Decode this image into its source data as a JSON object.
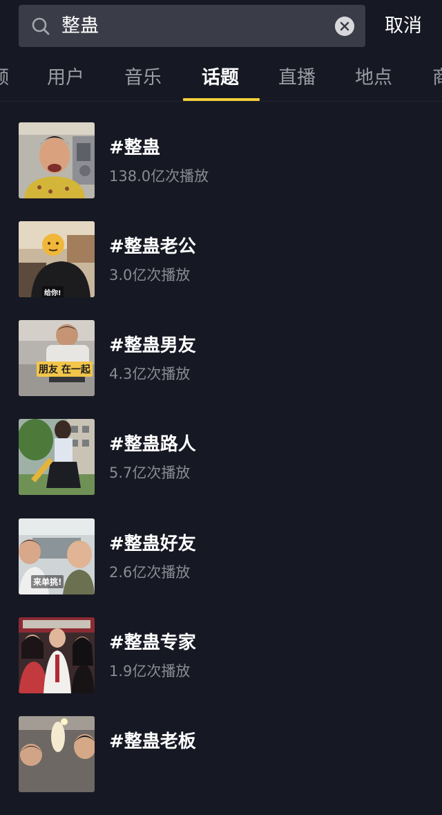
{
  "search": {
    "query": "整蛊",
    "cancel_label": "取消"
  },
  "tabs": [
    {
      "label": "频",
      "active": false
    },
    {
      "label": "用户",
      "active": false
    },
    {
      "label": "音乐",
      "active": false
    },
    {
      "label": "话题",
      "active": true
    },
    {
      "label": "直播",
      "active": false
    },
    {
      "label": "地点",
      "active": false
    },
    {
      "label": "商",
      "active": false
    }
  ],
  "topics": [
    {
      "title": "#整蛊",
      "plays": "138.0亿次播放",
      "thumb_caption": ""
    },
    {
      "title": "#整蛊老公",
      "plays": "3.0亿次播放",
      "thumb_caption": "给你!"
    },
    {
      "title": "#整蛊男友",
      "plays": "4.3亿次播放",
      "thumb_caption": "朋友 在一起"
    },
    {
      "title": "#整蛊路人",
      "plays": "5.7亿次播放",
      "thumb_caption": ""
    },
    {
      "title": "#整蛊好友",
      "plays": "2.6亿次播放",
      "thumb_caption": "来单挑!"
    },
    {
      "title": "#整蛊专家",
      "plays": "1.9亿次播放",
      "thumb_caption": ""
    },
    {
      "title": "#整蛊老板",
      "plays": "",
      "thumb_caption": ""
    }
  ],
  "colors": {
    "background": "#161823",
    "search_box": "#3a3c47",
    "accent_indicator": "#f4cf3a",
    "secondary_text": "#8a8b93"
  }
}
